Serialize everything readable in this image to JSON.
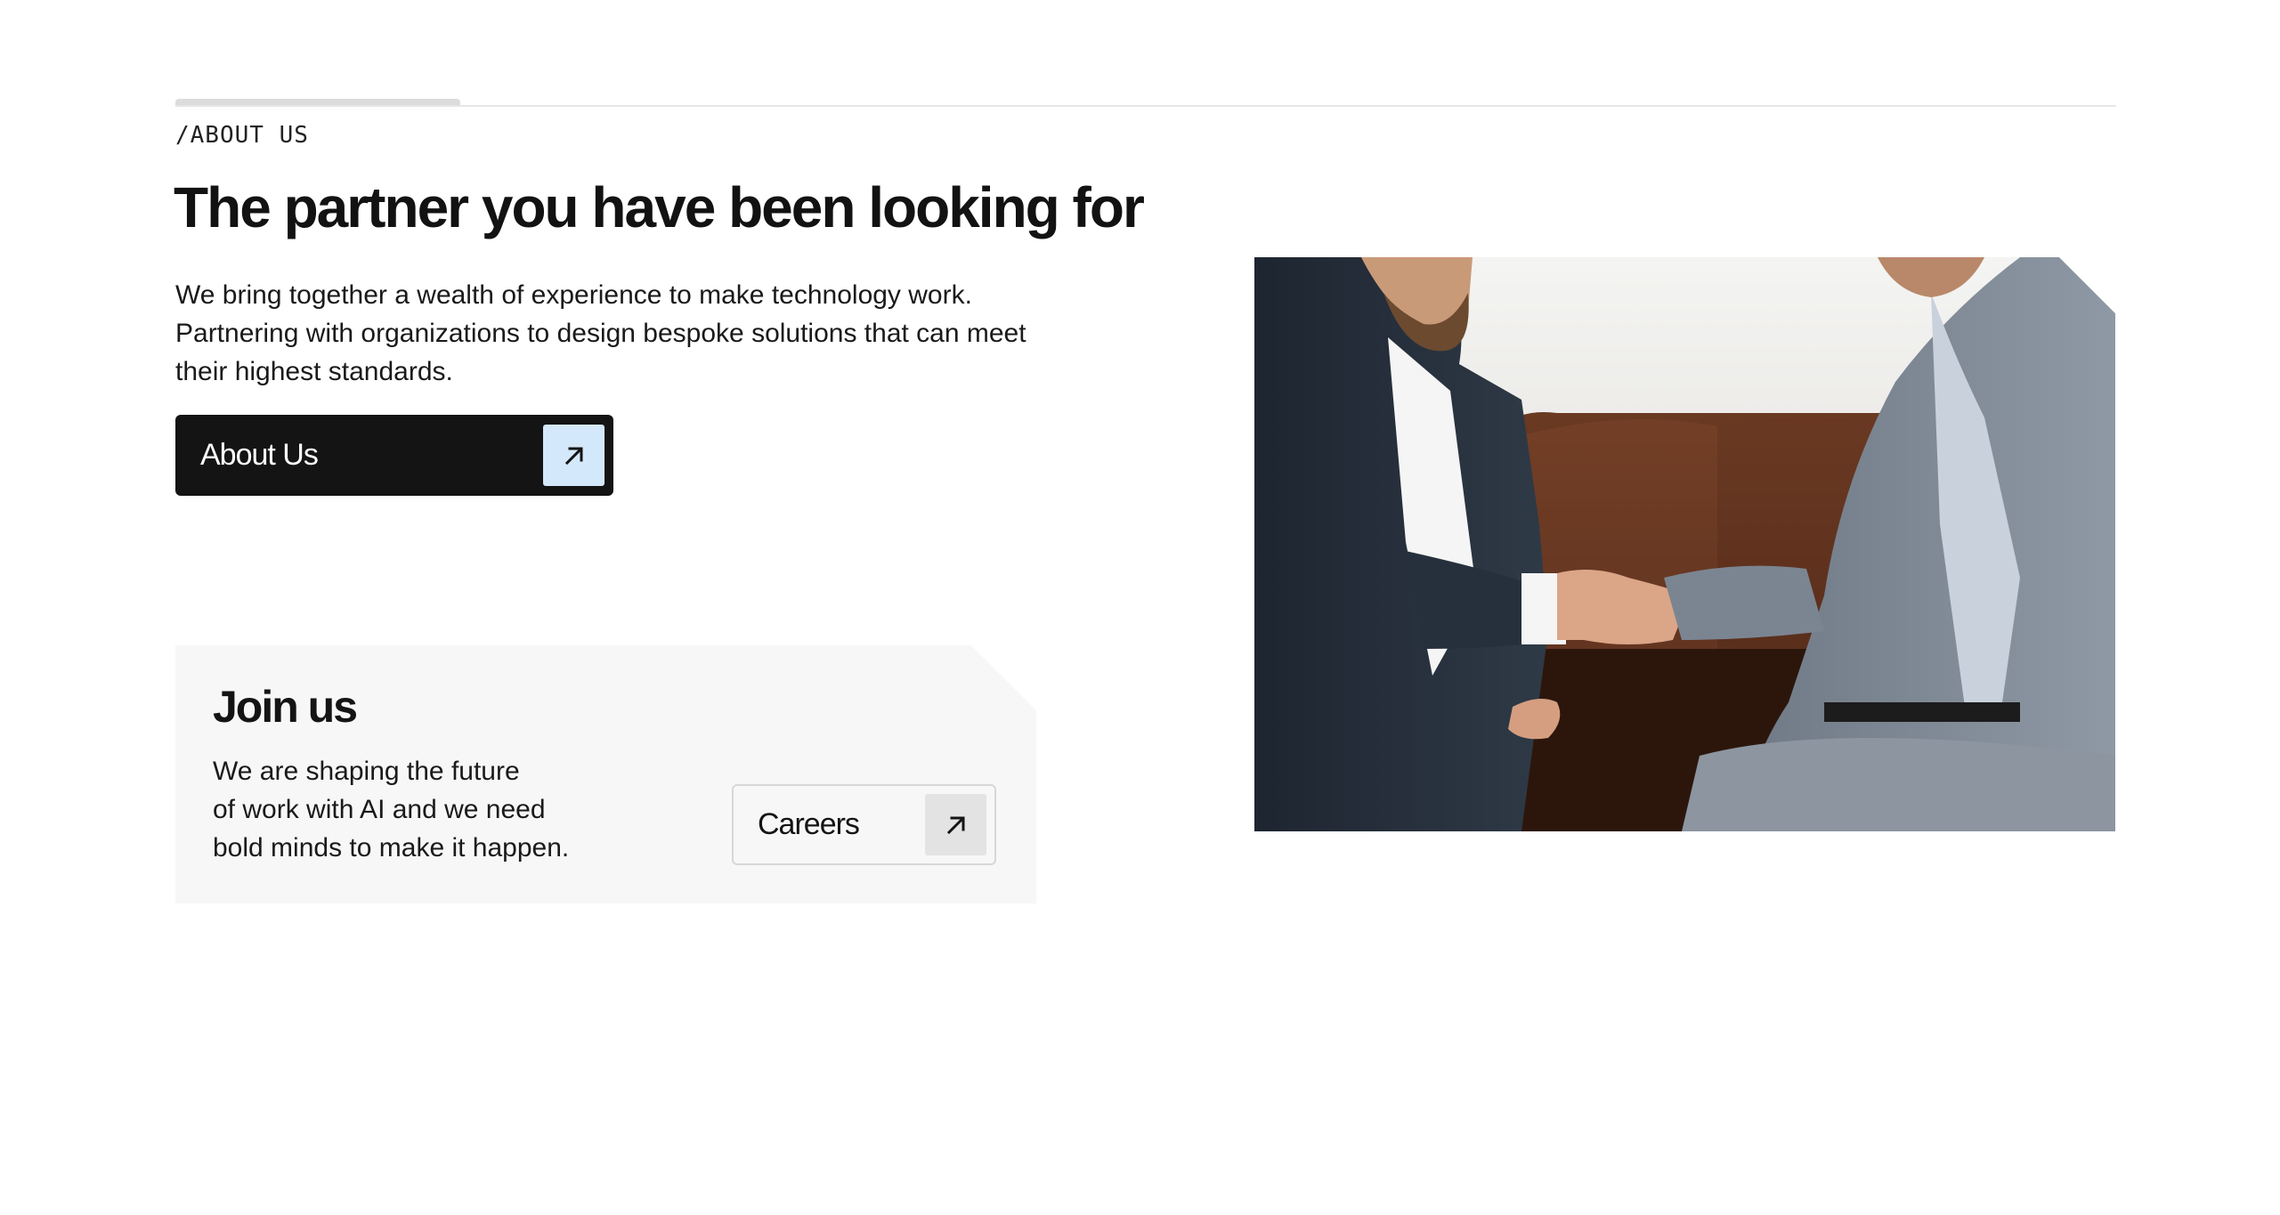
{
  "section": {
    "eyebrow": "/ABOUT US",
    "headline": "The partner you have been looking for",
    "intro": "We bring together a wealth of experience to make technology work. Partnering with organizations to design bespoke solutions that can meet their highest standards.",
    "about_button": {
      "label": "About Us",
      "icon": "arrow-up-right-icon",
      "icon_bg": "#d4e8fb"
    }
  },
  "join": {
    "title": "Join us",
    "text": "We are shaping the future\nof work with AI and we need\nbold minds to make it happen.",
    "careers_button": {
      "label": "Careers",
      "icon": "arrow-up-right-icon"
    }
  },
  "photo": {
    "subject": "business-handshake-photo"
  },
  "colors": {
    "primary_dark": "#141414",
    "card_bg": "#f7f7f7",
    "accent_light_blue": "#d4e8fb"
  }
}
